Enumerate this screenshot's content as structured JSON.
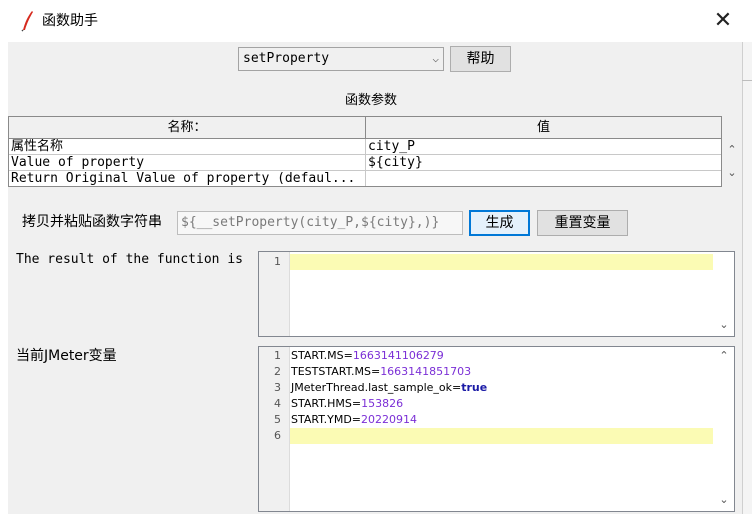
{
  "window": {
    "title": "函数助手",
    "close_glyph": "✕"
  },
  "function_select": {
    "value": "setProperty",
    "arrow": "⌵"
  },
  "help_button": "帮助",
  "params": {
    "title": "函数参数",
    "columns": [
      "名称：",
      "值"
    ],
    "rows": [
      {
        "name": "属性名称",
        "value": "city_P"
      },
      {
        "name": "Value of property",
        "value": "${city}"
      },
      {
        "name": "Return Original Value of property (defaul...",
        "value": ""
      }
    ]
  },
  "copy_row": {
    "label": "拷贝并粘贴函数字符串",
    "field_value": "${__setProperty(city_P,${city},)}",
    "generate_button": "生成",
    "reset_button": "重置变量"
  },
  "result": {
    "label": "The result of the function is",
    "line_numbers": [
      "1"
    ],
    "lines": [
      ""
    ]
  },
  "jmeter_vars": {
    "label": "当前JMeter变量",
    "line_numbers": [
      "1",
      "2",
      "3",
      "4",
      "5",
      "6"
    ],
    "lines": [
      {
        "key": "START.MS=",
        "value": "1663141106279"
      },
      {
        "key": "TESTSTART.MS=",
        "value": "1663141851703"
      },
      {
        "key": "JMeterThread.last_sample_ok=",
        "value": "true"
      },
      {
        "key": "START.HMS=",
        "value": "153826"
      },
      {
        "key": "START.YMD=",
        "value": "20220914"
      },
      {
        "key": "",
        "value": ""
      }
    ]
  },
  "scroll": {
    "up": "⌃",
    "down": "⌄"
  },
  "colors": {
    "accent": "#0078d7",
    "highlight_line": "#fbfbb4",
    "number": "#7b2fd6",
    "keyword": "#1a1aa6"
  }
}
